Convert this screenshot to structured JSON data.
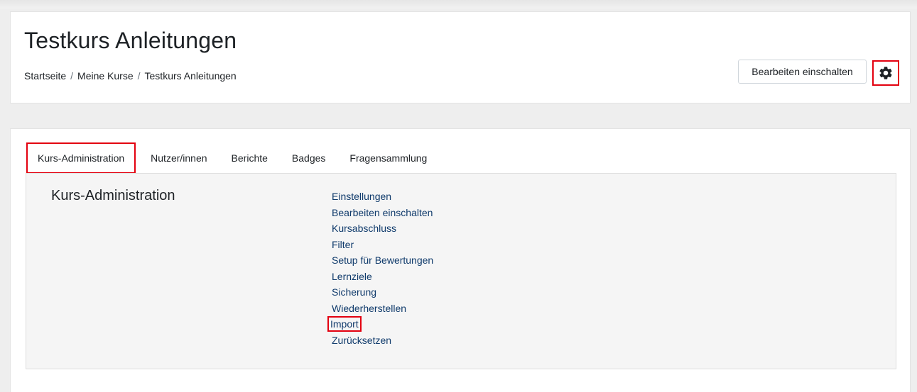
{
  "page": {
    "title": "Testkurs Anleitungen"
  },
  "breadcrumb": {
    "items": [
      "Startseite",
      "Meine Kurse",
      "Testkurs Anleitungen"
    ],
    "separator": "/"
  },
  "header": {
    "edit_button_label": "Bearbeiten einschalten",
    "settings_icon": "gear-icon"
  },
  "tabs": [
    {
      "label": "Kurs-Administration",
      "active": true
    },
    {
      "label": "Nutzer/innen",
      "active": false
    },
    {
      "label": "Berichte",
      "active": false
    },
    {
      "label": "Badges",
      "active": false
    },
    {
      "label": "Fragensammlung",
      "active": false
    }
  ],
  "panel": {
    "title": "Kurs-Administration",
    "links": [
      "Einstellungen",
      "Bearbeiten einschalten",
      "Kursabschluss",
      "Filter",
      "Setup für Bewertungen",
      "Lernziele",
      "Sicherung",
      "Wiederherstellen",
      "Import",
      "Zurücksetzen"
    ],
    "highlighted_link": "Import"
  },
  "colors": {
    "highlight": "#e3000f",
    "link": "#0f3a6b",
    "text": "#1d2125"
  }
}
